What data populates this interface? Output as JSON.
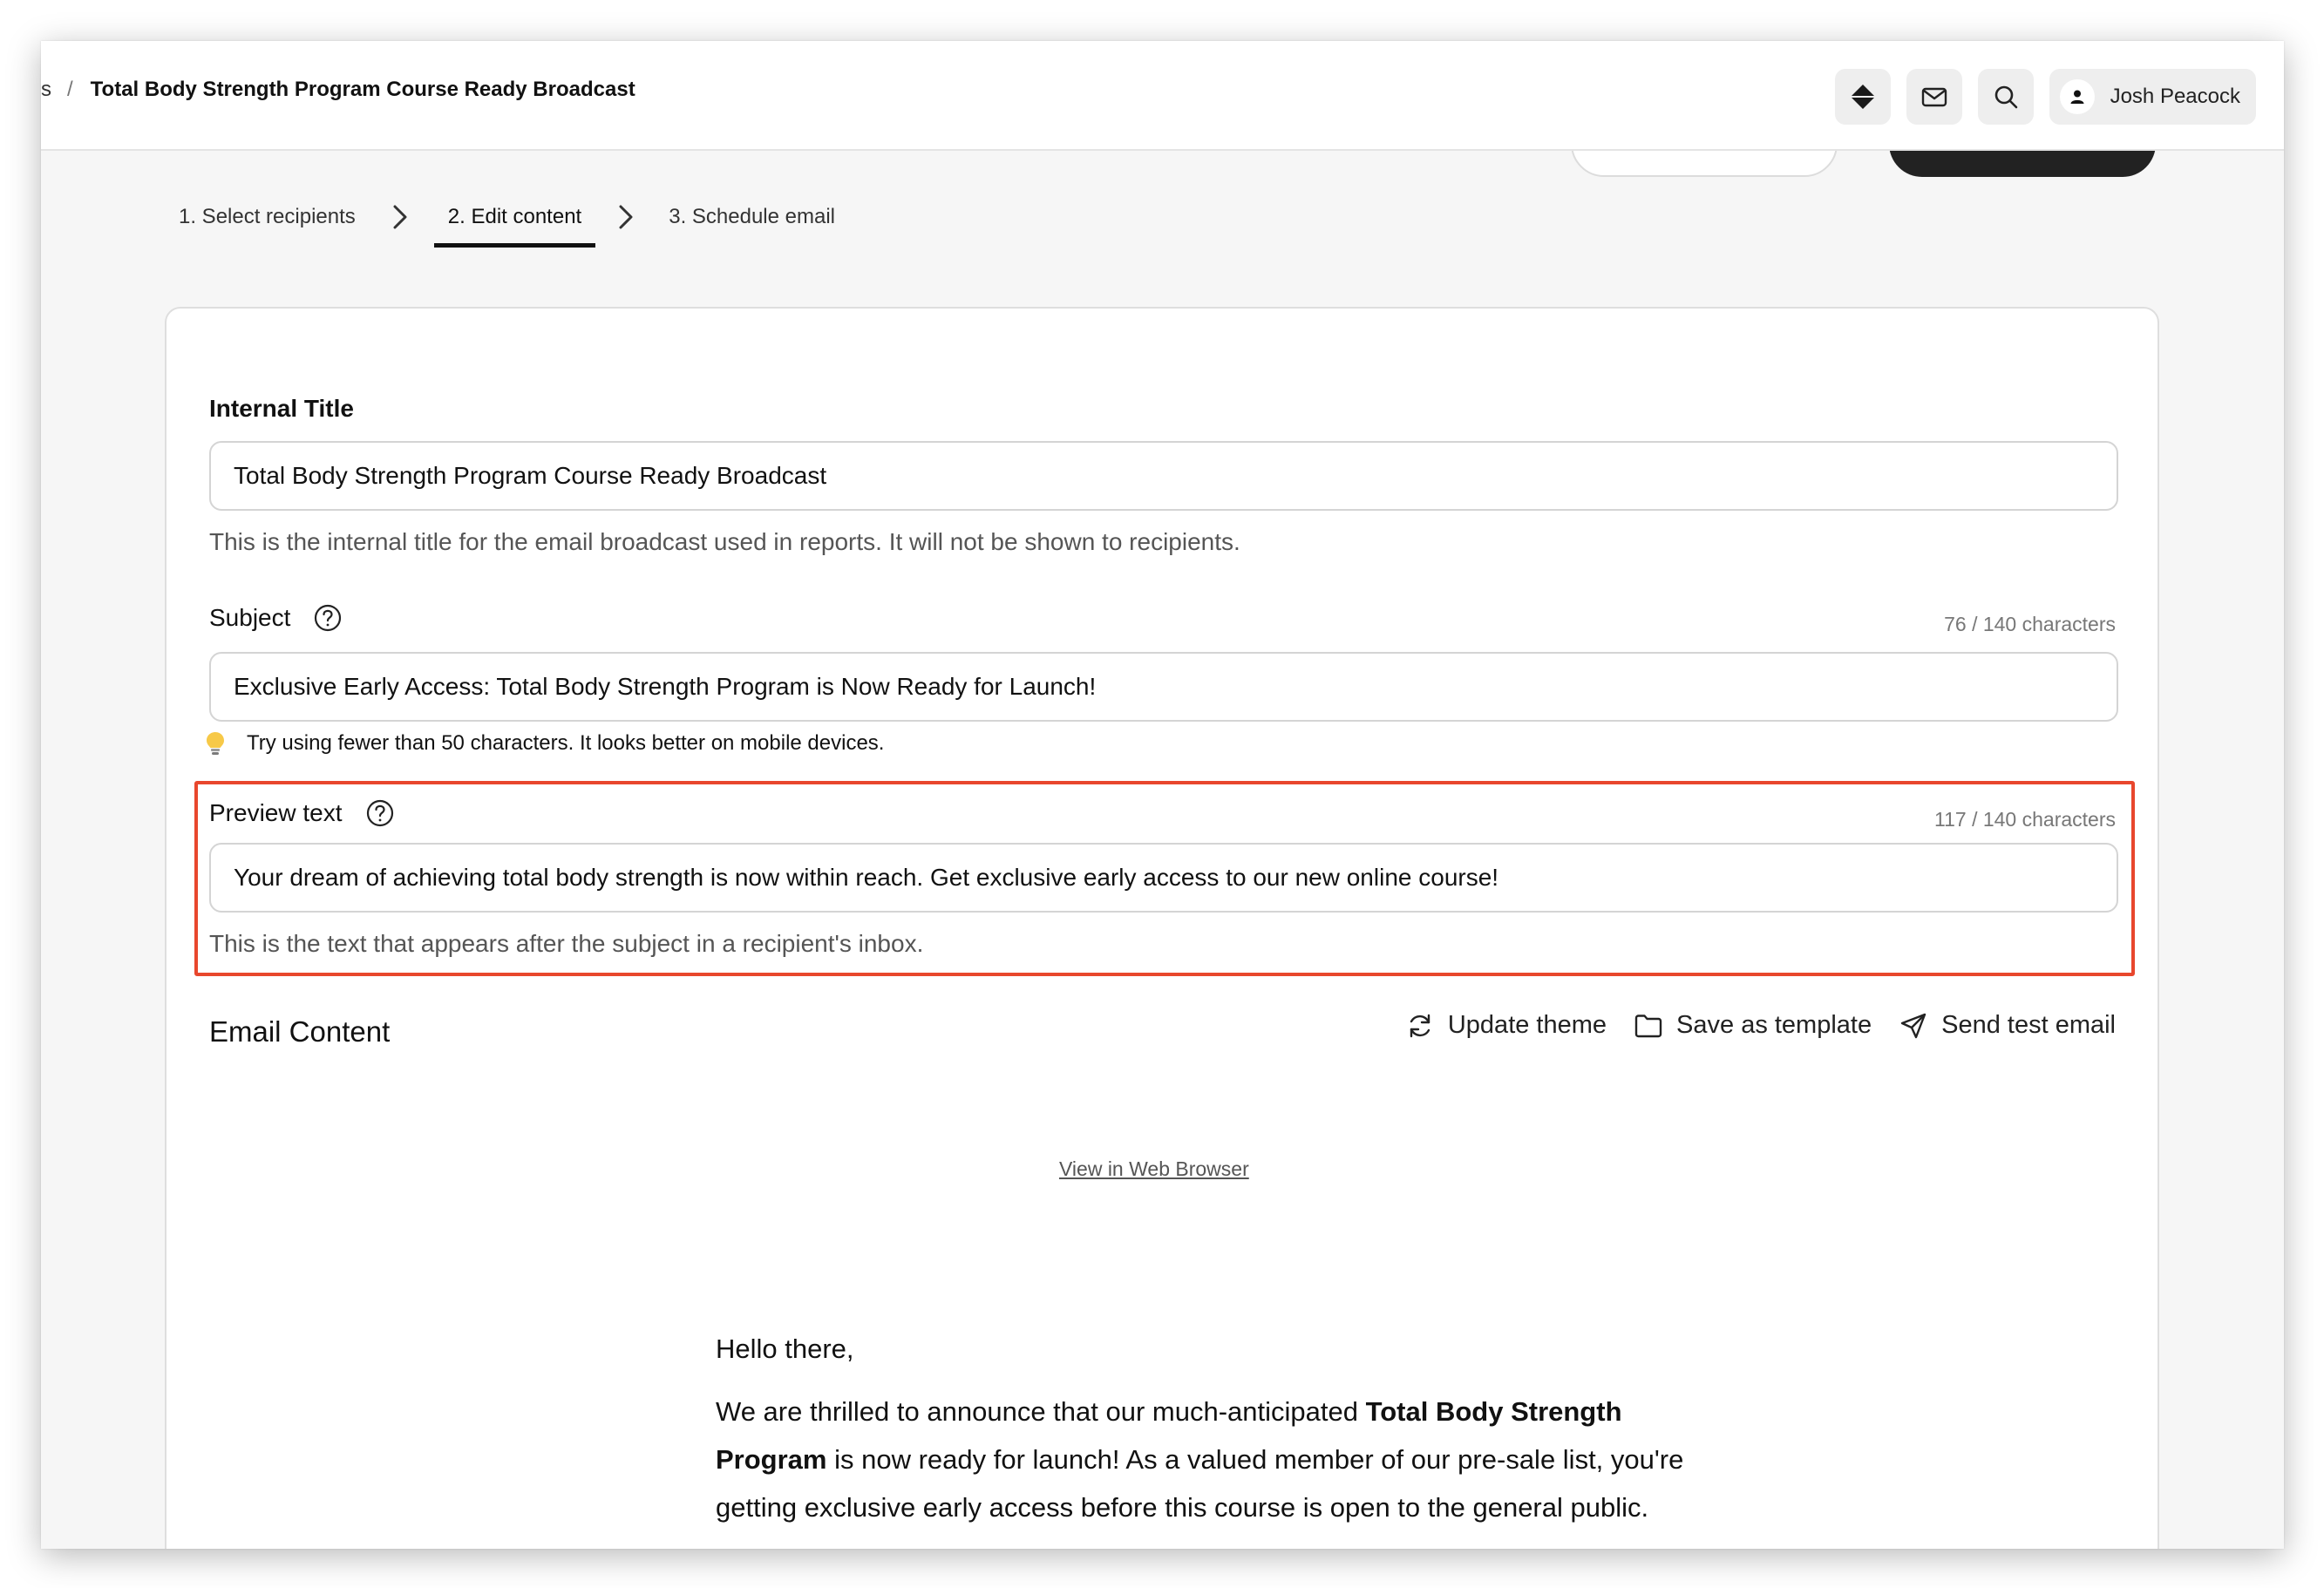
{
  "breadcrumb": {
    "previous": "s",
    "separator": "/",
    "current": "Total Body Strength Program Course Ready Broadcast"
  },
  "topbar": {
    "icons": [
      "diamond-icon",
      "mail-icon",
      "search-icon"
    ],
    "user": {
      "name": "Josh Peacock",
      "avatar_icon": "person-icon"
    }
  },
  "stepper": {
    "steps": [
      {
        "label": "1. Select recipients",
        "active": false
      },
      {
        "label": "2. Edit content",
        "active": true
      },
      {
        "label": "3. Schedule email",
        "active": false
      }
    ],
    "separator_icon": "chevron-right-icon"
  },
  "form": {
    "internal_title": {
      "label": "Internal Title",
      "value": "Total Body Strength Program Course Ready Broadcast",
      "help": "This is the internal title for the email broadcast used in reports. It will not be shown to recipients."
    },
    "subject": {
      "label": "Subject",
      "counter": "76 / 140 characters",
      "value": "Exclusive Early Access: Total Body Strength Program is Now Ready for Launch!",
      "tip": "Try using fewer than 50 characters. It looks better on mobile devices.",
      "tip_icon": "lightbulb-icon"
    },
    "preview_text": {
      "label": "Preview text",
      "counter": "117 / 140 characters",
      "value": "Your dream of achieving total body strength is now within reach. Get exclusive early access to our new online course!",
      "help": "This is the text that appears after the subject in a recipient's inbox."
    }
  },
  "email_content": {
    "title": "Email Content",
    "actions": {
      "update_theme": "Update theme",
      "save_template": "Save as template",
      "send_test": "Send test email"
    },
    "view_in_browser": "View in Web Browser",
    "greeting": "Hello there,",
    "paragraph": {
      "pre": "We are thrilled to announce that our much-anticipated ",
      "bold": "Total Body Strength Program",
      "post": " is now ready for launch! As a valued member of our pre-sale list, you're getting exclusive early access before this course is open to the general public."
    }
  },
  "colors": {
    "highlight": "#e8472d",
    "surface": "#f6f6f6",
    "dark_button": "#222222"
  }
}
